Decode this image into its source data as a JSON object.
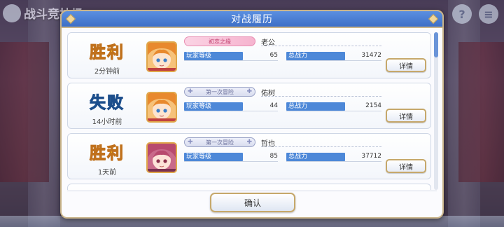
{
  "background": {
    "title": "战斗竞技场",
    "help_icon": "question-icon",
    "menu_icon": "menu-icon"
  },
  "modal": {
    "title": "对战履历",
    "confirm_label": "确认"
  },
  "labels": {
    "player_level": "玩家等级",
    "total_power": "总战力",
    "detail": "详情"
  },
  "entries": [
    {
      "result": "胜利",
      "result_type": "win",
      "time": "2分钟前",
      "title": "初恋之缘",
      "title_style": "pink",
      "name": "老公",
      "level": "65",
      "power": "31472",
      "avatar": "orange-hair-girl"
    },
    {
      "result": "失败",
      "result_type": "lose",
      "time": "14小时前",
      "title": "第一次冒险",
      "title_style": "plain",
      "name": "佑树",
      "level": "44",
      "power": "2154",
      "avatar": "orange-hair-girl"
    },
    {
      "result": "胜利",
      "result_type": "win",
      "time": "1天前",
      "title": "第一次冒险",
      "title_style": "plain",
      "name": "哲也",
      "level": "85",
      "power": "37712",
      "avatar": "pink-hair-girl"
    }
  ],
  "colors": {
    "win": "#f7c21d",
    "lose": "#2e78c8",
    "header": "#3d6fc6",
    "stat_label": "#4d88d8",
    "border_gold": "#c9b48a"
  }
}
